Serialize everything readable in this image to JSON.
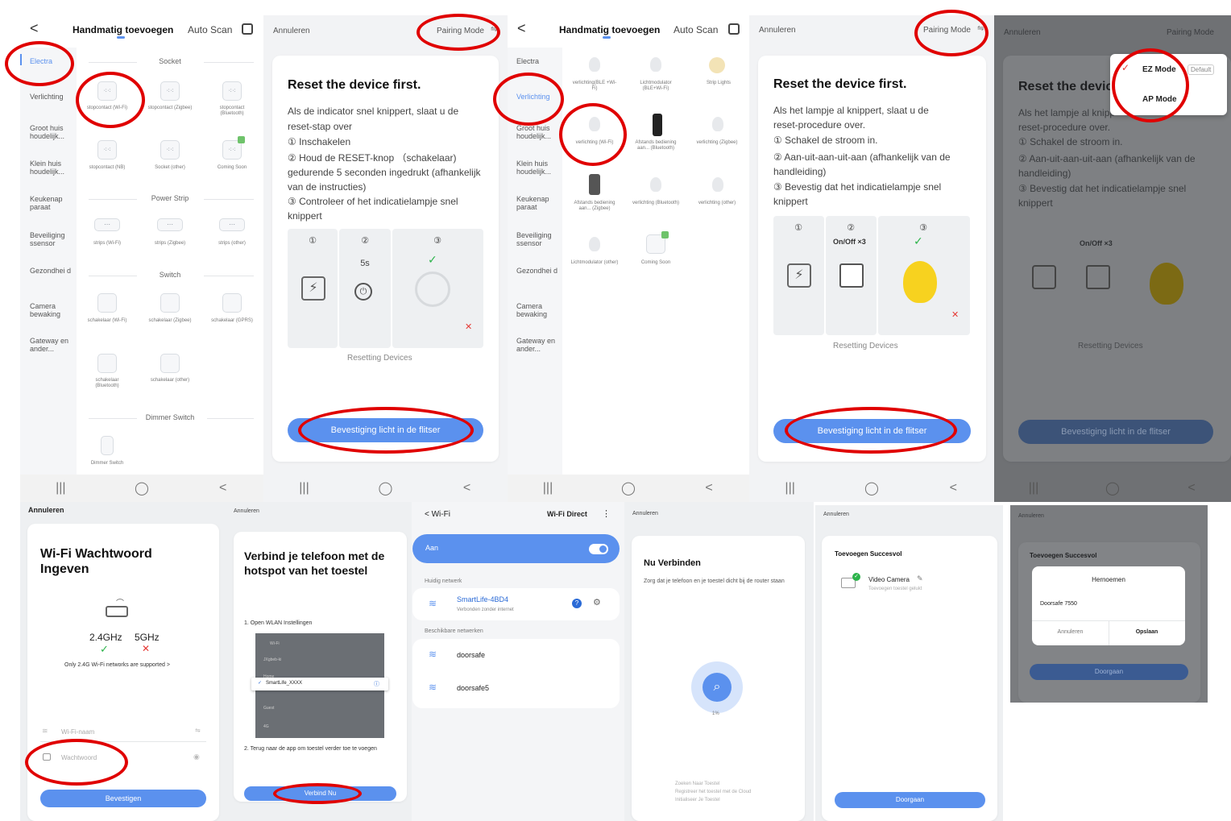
{
  "s1": {
    "back": "<",
    "tab_manual": "Handmatig toevoegen",
    "tab_auto": "Auto Scan",
    "categories": [
      "Electra",
      "Verlichting",
      "Groot huis houdelijk...",
      "Klein huis houdelijk...",
      "Keukenap paraat",
      "Beveiliging ssensor",
      "Gezondhei d",
      "Camera bewaking",
      "Gateway en ander..."
    ],
    "sections": [
      "Socket",
      "Power Strip",
      "Switch",
      "Dimmer Switch"
    ],
    "socket_items": [
      "stopcontact (Wi-Fi)",
      "stopcontact (Zigbee)",
      "stopcontact (Bluetooth)",
      "stopcontact (NB)",
      "Socket (other)",
      "Coming Soon"
    ],
    "strip_items": [
      "strips (Wi-Fi)",
      "strips (Zigbee)",
      "strips (other)"
    ],
    "switch_items": [
      "schakelaar (Wi-Fi)",
      "schakelaar (Zigbee)",
      "schakelaar (GPRS)",
      "schakelaar (Bluetooth)",
      "schakelaar (other)"
    ],
    "dimmer_items": [
      "Dimmer Switch"
    ]
  },
  "s2": {
    "cancel": "Annuleren",
    "pairing": "Pairing Mode",
    "title": "Reset the device first.",
    "lines": [
      "Als de indicator snel knippert, slaat u de",
      "reset-stap over",
      "① Inschakelen",
      "② Houd de RESET-knop （schakelaar)",
      "gedurende 5 seconden ingedrukt (afhankelijk",
      "van de instructies)",
      "③ Controleer of het indicatielampje snel",
      "knippert"
    ],
    "steps": [
      "①",
      "②",
      "③"
    ],
    "time": "5s",
    "resetting": "Resetting Devices",
    "confirm": "Bevestiging licht in de flitser"
  },
  "s3": {
    "tab_manual": "Handmatig toevoegen",
    "tab_auto": "Auto Scan",
    "categories": [
      "Electra",
      "Verlichting",
      "Groot huis houdelijk...",
      "Klein huis houdelijk...",
      "Keukenap paraat",
      "Beveiliging ssensor",
      "Gezondhei d",
      "Camera bewaking",
      "Gateway en ander..."
    ],
    "items": [
      "verlichting(BLE +Wi-Fi)",
      "Lichtmodulator (BLE+Wi-Fi)",
      "Strip Lights",
      "verlichting (Wi-Fi)",
      "Afstands bediening aan... (Bluetooth)",
      "verlichting (Zigbee)",
      "Afstands bediening aan... (Zigbee)",
      "verlichting (Bluetooth)",
      "verlichting (other)",
      "Lichtmodulator (other)",
      "Coming Soon"
    ]
  },
  "s4": {
    "cancel": "Annuleren",
    "pairing": "Pairing Mode",
    "title": "Reset the device first.",
    "lines": [
      "Als het lampje al knippert, slaat u de",
      "reset-procedure over.",
      "① Schakel de stroom in.",
      "② Aan-uit-aan-uit-aan (afhankelijk van de",
      "handleiding)",
      "③ Bevestig dat het indicatielampje snel",
      "knippert"
    ],
    "steps": [
      "①",
      "②",
      "③"
    ],
    "onoff": "On/Off ×3",
    "resetting": "Resetting Devices",
    "confirm": "Bevestiging licht in de flitser"
  },
  "s5": {
    "cancel": "Annuleren",
    "pairing": "Pairing Mode",
    "title": "Reset the devic",
    "lines": [
      "Als het lampje al knipp",
      "reset-procedure over.",
      "① Schakel de stroom in.",
      "② Aan-uit-aan-uit-aan (afhankelijk van de",
      "handleiding)",
      "③ Bevestig dat het indicatielampje snel",
      "knippert"
    ],
    "onoff": "On/Off ×3",
    "resetting": "Resetting Devices",
    "confirm": "Bevestiging licht in de flitser",
    "menu_ez": "EZ Mode",
    "menu_default": "Default",
    "menu_ap": "AP Mode"
  },
  "s6": {
    "cancel": "Annuleren",
    "title": "Wi-Fi Wachtwoord Ingeven",
    "band24": "2.4GHz",
    "band5": "5GHz",
    "note": "Only 2.4G Wi-Fi networks are supported >",
    "wifi_placeholder": "Wi-Fi-naam",
    "pw_placeholder": "Wachtwoord",
    "confirm": "Bevestigen"
  },
  "s7": {
    "cancel": "Annuleren",
    "title": "Verbind je telefoon met de hotspot van het toestel",
    "step1": "1. Open WLAN Instellingen",
    "ssid": "SmartLife_XXXX",
    "step2": "2. Terug naar de app om toestel verder toe te voegen",
    "connect": "Verbind Nu",
    "list": [
      "Wi-Fi",
      "JXgbeb-ki",
      "Home",
      "",
      "Guest",
      "4G"
    ]
  },
  "s8": {
    "back": "<  Wi-Fi",
    "direct": "Wi-Fi Direct",
    "on": "Aan",
    "current_label": "Huidig netwerk",
    "current_name": "SmartLife-4BD4",
    "current_status": "Verbonden zonder internet",
    "available_label": "Beschikbare netwerken",
    "networks": [
      "doorsafe",
      "doorsafe5"
    ]
  },
  "s9": {
    "cancel": "Annuleren",
    "title": "Nu Verbinden",
    "sub": "Zorg dat je telefoon en je toestel dicht bij de router staan",
    "percent": "1%",
    "steps": [
      "Zoeken Naar Toestel",
      "Registreer het toestel met de Cloud",
      "Initialiseer Je Toestel"
    ]
  },
  "s10": {
    "cancel": "Annuleren",
    "title": "Toevoegen Succesvol",
    "device": "Video Camera",
    "status": "Toevoegen toestel gelukt",
    "next": "Doorgaan"
  },
  "s11": {
    "cancel": "Annuleren",
    "title": "Toevoegen Succesvol",
    "dialog_title": "Hernoemen",
    "name": "Doorsafe 7550",
    "cancel_btn": "Annuleren",
    "save_btn": "Opslaan",
    "next": "Doorgaan"
  },
  "nav": [
    "|||",
    "◯",
    "<"
  ],
  "colors": {
    "accent": "#5b91ee",
    "highlight": "#e00000",
    "success": "#2bb34a",
    "error": "#e53935"
  }
}
